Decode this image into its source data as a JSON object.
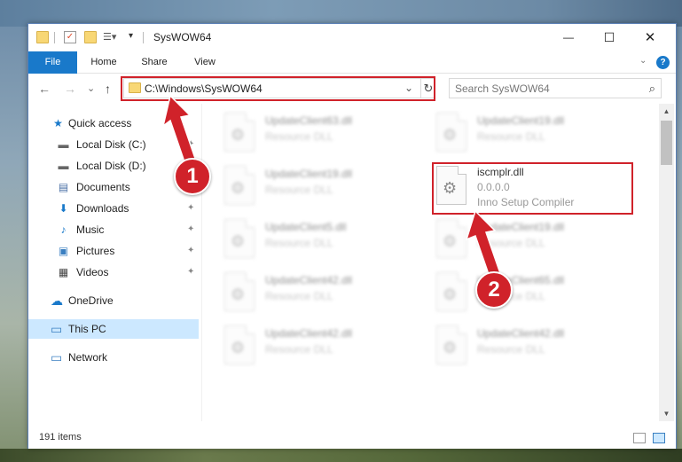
{
  "window": {
    "title": "SysWOW64",
    "close_glyph": "✕",
    "maximize_glyph": "☐",
    "minimize_glyph": "—"
  },
  "ribbon": {
    "tabs": [
      "File",
      "Home",
      "Share",
      "View"
    ],
    "help_glyph": "?"
  },
  "nav": {
    "back_glyph": "←",
    "forward_glyph": "→",
    "recent_glyph": "⌄",
    "up_glyph": "↑",
    "address": "C:\\Windows\\SysWOW64",
    "refresh_glyph": "↻",
    "search_placeholder": "Search SysWOW64",
    "search_glyph": "⌕"
  },
  "sidebar": {
    "items": [
      {
        "label": "Quick access",
        "icon": "star-icon",
        "glyph": "★",
        "color": "#1979ca",
        "pinned": false
      },
      {
        "label": "Local Disk (C:)",
        "icon": "drive-icon",
        "glyph": "▬",
        "color": "#555555",
        "pinned": true
      },
      {
        "label": "Local Disk (D:)",
        "icon": "drive-icon",
        "glyph": "▬",
        "color": "#555555",
        "pinned": false
      },
      {
        "label": "Documents",
        "icon": "documents-icon",
        "glyph": "▤",
        "color": "#4a6fa5",
        "pinned": true
      },
      {
        "label": "Downloads",
        "icon": "download-icon",
        "glyph": "⬇",
        "color": "#1979ca",
        "pinned": true
      },
      {
        "label": "Music",
        "icon": "music-icon",
        "glyph": "♪",
        "color": "#1979ca",
        "pinned": true
      },
      {
        "label": "Pictures",
        "icon": "pictures-icon",
        "glyph": "▣",
        "color": "#3a7fc1",
        "pinned": true
      },
      {
        "label": "Videos",
        "icon": "videos-icon",
        "glyph": "▦",
        "color": "#444444",
        "pinned": true
      },
      {
        "label": "OneDrive",
        "icon": "cloud-icon",
        "glyph": "☁",
        "color": "#1979ca",
        "pinned": false
      },
      {
        "label": "This PC",
        "icon": "computer-icon",
        "glyph": "▭",
        "color": "#3a7fc1",
        "pinned": false
      },
      {
        "label": "Network",
        "icon": "network-icon",
        "glyph": "▭",
        "color": "#3a7fc1",
        "pinned": false
      }
    ],
    "pin_glyph": "📌"
  },
  "files": [
    {
      "name": "UpdateClient63.dll",
      "sub": "Resource DLL"
    },
    {
      "name": "UpdateClient19.dll",
      "sub": "Resource DLL"
    },
    {
      "name": "UpdateClient19.dll",
      "sub": "Resource DLL"
    },
    {
      "name": "iscmplr.dll",
      "sub": "0.0.0.0",
      "sub2": "Inno Setup Compiler"
    },
    {
      "name": "UpdateClient5.dll",
      "sub": "Resource DLL"
    },
    {
      "name": "UpdateClient19.dll",
      "sub": "Resource DLL"
    },
    {
      "name": "UpdateClient42.dll",
      "sub": "Resource DLL"
    },
    {
      "name": "UpdateClient65.dll",
      "sub": "Resource DLL"
    },
    {
      "name": "UpdateClient42.dll",
      "sub": "Resource DLL"
    },
    {
      "name": "UpdateClient42.dll",
      "sub": "Resource DLL"
    }
  ],
  "status": {
    "item_count": "191 items"
  },
  "callouts": {
    "step1": "1",
    "step2": "2",
    "color": "#d0222a"
  }
}
